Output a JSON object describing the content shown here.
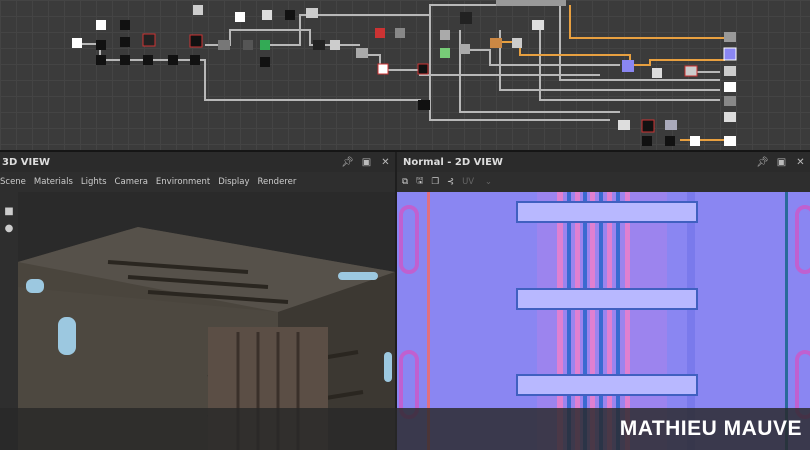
{
  "graph": {
    "name": "node-graph"
  },
  "view3d": {
    "title": "3D VIEW",
    "menu": [
      "Scene",
      "Materials",
      "Lights",
      "Camera",
      "Environment",
      "Display",
      "Renderer"
    ]
  },
  "view2d": {
    "title": "Normal - 2D VIEW",
    "uv_label": "UV"
  },
  "icons": {
    "pin": "pin-icon",
    "maximize": "maximize-icon",
    "close": "close-icon"
  },
  "colors": {
    "normal_bg": "#8a86f2",
    "accent_wire": "#e8a040"
  },
  "banner": {
    "author": "MATHIEU MAUVE"
  }
}
